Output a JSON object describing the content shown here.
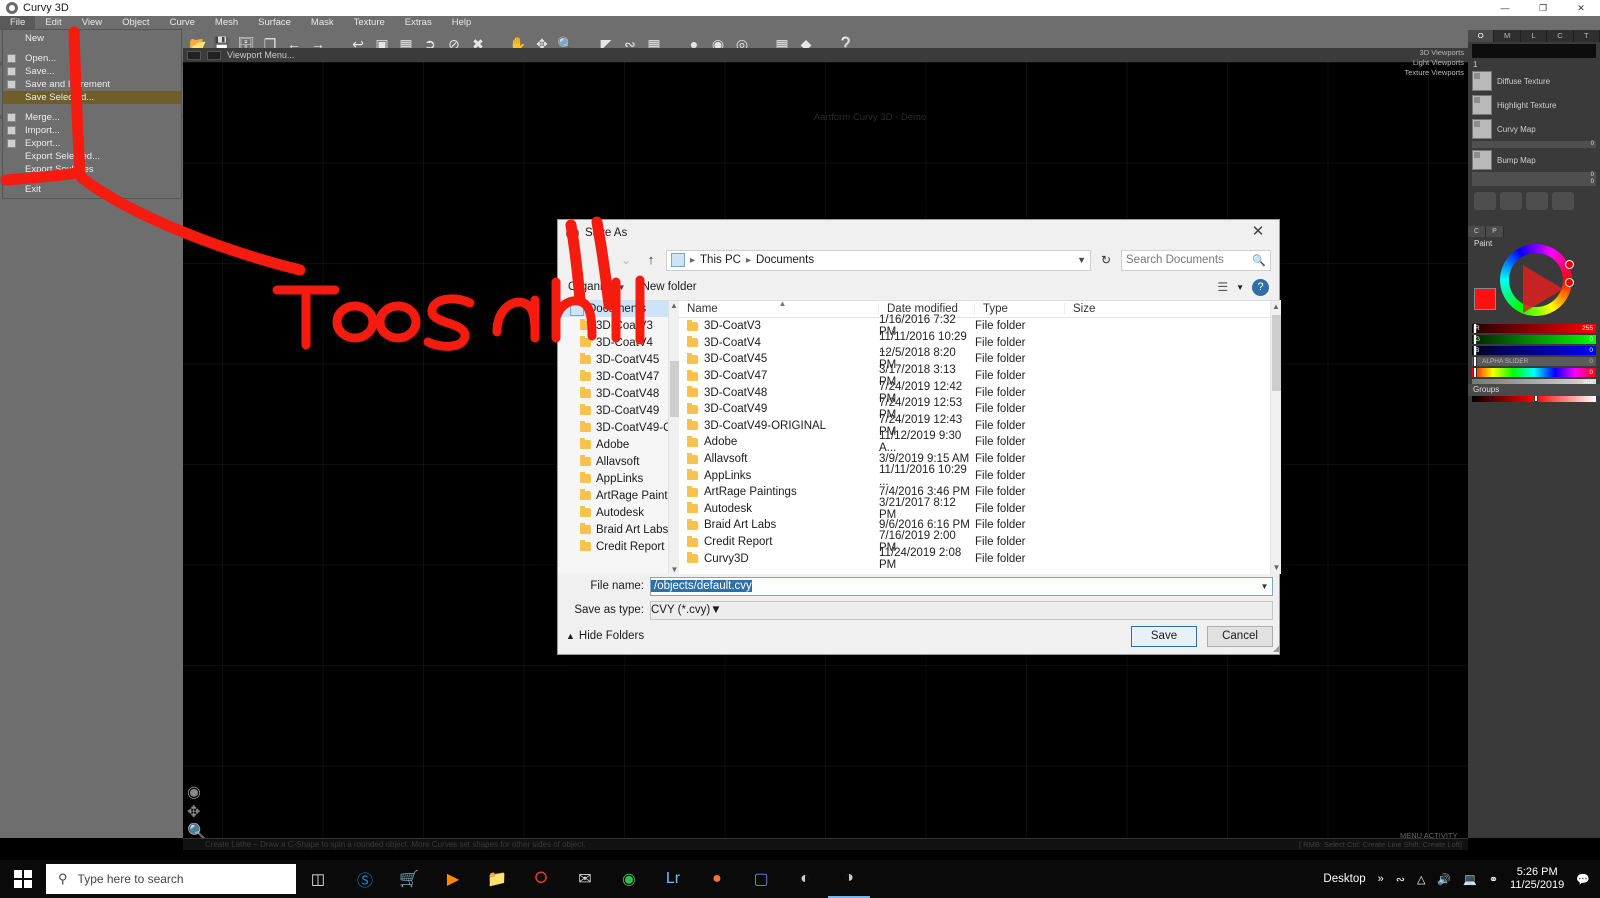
{
  "app": {
    "title": "Curvy 3D",
    "logo_icon": "curvy-logo-icon",
    "window_buttons": [
      {
        "name": "minimize",
        "glyph": "—"
      },
      {
        "name": "restore",
        "glyph": "❐"
      },
      {
        "name": "close",
        "glyph": "✕"
      }
    ],
    "menubar": [
      "File",
      "Edit",
      "View",
      "Object",
      "Curve",
      "Mesh",
      "Surface",
      "Mask",
      "Texture",
      "Extras",
      "Help"
    ],
    "active_menu": "File",
    "toolbar_icons": [
      "open-icon",
      "save-icon",
      "save-increment-icon",
      "merge-icon",
      "back-arrow-icon",
      "forward-arrow-icon",
      "undo-icon",
      "redo-icon",
      "delete-icon",
      "select-icon",
      "ban-icon",
      "cancel-icon",
      "pan-icon",
      "move-icon",
      "zoom-icon",
      "angle-icon",
      "curve-icon",
      "grid-icon",
      "sphere-icon",
      "wire-sphere-icon",
      "lattice-sphere-icon",
      "plane-icon",
      "gizmo-icon",
      "help-icon"
    ],
    "viewport_menu_label": "Viewport Menu...",
    "watermark": "Aartform Curvy 3D - Demo",
    "viewport_lists": [
      "3D Viewports",
      "Light Viewports",
      "Texture Viewports"
    ],
    "status_text": "Create Lathe – Draw a C-Shape to spin a rounded object. More Curves set shapes for other sides of object.",
    "status_hint": "[ RMB: Select   Ctrl: Create Line   Shift: Create Loft]",
    "menu_activity": "MENU   ACTIVITY"
  },
  "file_menu": {
    "items": [
      {
        "label": "New",
        "icon": "",
        "selected": false,
        "gap_after": true
      },
      {
        "label": "Open...",
        "icon": "folder-icon",
        "selected": false
      },
      {
        "label": "Save...",
        "icon": "save-icon",
        "selected": false
      },
      {
        "label": "Save and Increment",
        "icon": "save-increment-icon",
        "selected": false
      },
      {
        "label": "Save Selected...",
        "icon": "",
        "selected": true,
        "gap_after": true
      },
      {
        "label": "Merge...",
        "icon": "merge-icon",
        "selected": false
      },
      {
        "label": "Import...",
        "icon": "import-icon",
        "selected": false
      },
      {
        "label": "Export...",
        "icon": "export-icon",
        "selected": false
      },
      {
        "label": "Export Selected...",
        "icon": "",
        "selected": false
      },
      {
        "label": "Export Sculpties",
        "icon": "",
        "selected": false,
        "gap_after": true
      },
      {
        "label": "Exit",
        "icon": "",
        "selected": false
      }
    ]
  },
  "right_panel": {
    "tabs": [
      "O",
      "M",
      "L",
      "C",
      "T"
    ],
    "active_tab": "O",
    "index_label": "1",
    "textures": [
      {
        "label": "Diffuse Texture",
        "value": ""
      },
      {
        "label": "Highlight Texture",
        "value": ""
      },
      {
        "label": "Curvy Map",
        "value": "0"
      },
      {
        "label": "Bump Map",
        "value": "0"
      }
    ],
    "extra_slider_value": "0"
  },
  "color_picker": {
    "tabs": [
      "C",
      "P"
    ],
    "active_tab": "P",
    "mode_label": "Paint",
    "swatch_color": "#ff1111",
    "sliders": [
      {
        "label": "R",
        "value": "255",
        "color": "#ff0000"
      },
      {
        "label": "G",
        "value": "0",
        "color": "#00ff00"
      },
      {
        "label": "B",
        "value": "0",
        "color": "#0000ff"
      },
      {
        "label": "ALPHA SLIDER",
        "value": "0",
        "color": "#5a5a5a"
      },
      {
        "label": "",
        "value": "0",
        "color": "rainbow"
      },
      {
        "label": "",
        "value": "255",
        "color": "#bdbdbd"
      }
    ],
    "groups_label": "Groups"
  },
  "dialog": {
    "title": "Save As",
    "logo_icon": "curvy-logo-icon",
    "close_glyph": "✕",
    "nav": {
      "back_glyph": "←",
      "forward_glyph": "→",
      "recent_glyph": "⌄",
      "up_glyph": "↑",
      "breadcrumb": [
        "This PC",
        "Documents"
      ],
      "breadcrumb_icon": "computer-icon",
      "refresh_glyph": "↻",
      "search_placeholder": "Search Documents",
      "search_icon": "search-icon"
    },
    "toolbar": {
      "organize_label": "Organize",
      "new_folder_label": "New folder",
      "view_icon": "view-list-icon",
      "help_label": "?"
    },
    "nav_pane": {
      "root": "Documents",
      "root_icon": "documents-icon",
      "items": [
        "3D-CoatV3",
        "3D-CoatV4",
        "3D-CoatV45",
        "3D-CoatV47",
        "3D-CoatV48",
        "3D-CoatV49",
        "3D-CoatV49-O",
        "Adobe",
        "Allavsoft",
        "AppLinks",
        "ArtRage Paintin",
        "Autodesk",
        "Braid Art Labs",
        "Credit Report"
      ]
    },
    "columns": [
      "Name",
      "Date modified",
      "Type",
      "Size"
    ],
    "sorted_column": "Name",
    "files": [
      {
        "name": "3D-CoatV3",
        "date": "1/16/2016 7:32 PM",
        "type": "File folder",
        "size": ""
      },
      {
        "name": "3D-CoatV4",
        "date": "11/11/2016 10:29 ...",
        "type": "File folder",
        "size": ""
      },
      {
        "name": "3D-CoatV45",
        "date": "12/5/2018 8:20 PM",
        "type": "File folder",
        "size": ""
      },
      {
        "name": "3D-CoatV47",
        "date": "3/17/2018 3:13 PM",
        "type": "File folder",
        "size": ""
      },
      {
        "name": "3D-CoatV48",
        "date": "7/24/2019 12:42 PM",
        "type": "File folder",
        "size": ""
      },
      {
        "name": "3D-CoatV49",
        "date": "7/24/2019 12:53 PM",
        "type": "File folder",
        "size": ""
      },
      {
        "name": "3D-CoatV49-ORIGINAL",
        "date": "7/24/2019 12:43 PM",
        "type": "File folder",
        "size": ""
      },
      {
        "name": "Adobe",
        "date": "11/12/2019 9:30 A...",
        "type": "File folder",
        "size": ""
      },
      {
        "name": "Allavsoft",
        "date": "3/9/2019 9:15 AM",
        "type": "File folder",
        "size": ""
      },
      {
        "name": "AppLinks",
        "date": "11/11/2016 10:29 ...",
        "type": "File folder",
        "size": ""
      },
      {
        "name": "ArtRage Paintings",
        "date": "7/4/2016 3:46 PM",
        "type": "File folder",
        "size": ""
      },
      {
        "name": "Autodesk",
        "date": "3/21/2017 8:12 PM",
        "type": "File folder",
        "size": ""
      },
      {
        "name": "Braid Art Labs",
        "date": "9/6/2016 6:16 PM",
        "type": "File folder",
        "size": ""
      },
      {
        "name": "Credit Report",
        "date": "7/16/2019 2:00 PM",
        "type": "File folder",
        "size": ""
      },
      {
        "name": "Curvy3D",
        "date": "11/24/2019 2:08 PM",
        "type": "File folder",
        "size": ""
      }
    ],
    "filename_label": "File name:",
    "filename_value": "/objects/default.cvy",
    "filetype_label": "Save as type:",
    "filetype_value": "CVY (*.cvy)",
    "hide_folders_label": "Hide Folders",
    "save_label": "Save",
    "cancel_label": "Cancel"
  },
  "annotation": {
    "text": "Too small",
    "color": "#f51b0f"
  },
  "taskbar": {
    "start_icon": "windows-start-icon",
    "search_placeholder": "Type here to search",
    "search_icon": "search-icon",
    "task_view_icon": "task-view-icon",
    "apps": [
      "edge-icon",
      "store-icon",
      "movies-icon",
      "explorer-icon",
      "opera-icon",
      "mail-icon",
      "chrome-icon",
      "lightroom-icon",
      "firefox-icon",
      "teams-icon",
      "curvy-icon",
      "curvy-active-icon"
    ],
    "desktop_label": "Desktop",
    "overflow_glyph": "»",
    "tray_icons": [
      "share-icon",
      "chevron-up-icon",
      "volume-icon",
      "display-icon",
      "bluetooth-icon"
    ],
    "time": "5:26 PM",
    "date": "11/25/2019",
    "action_center_icon": "notification-icon"
  }
}
